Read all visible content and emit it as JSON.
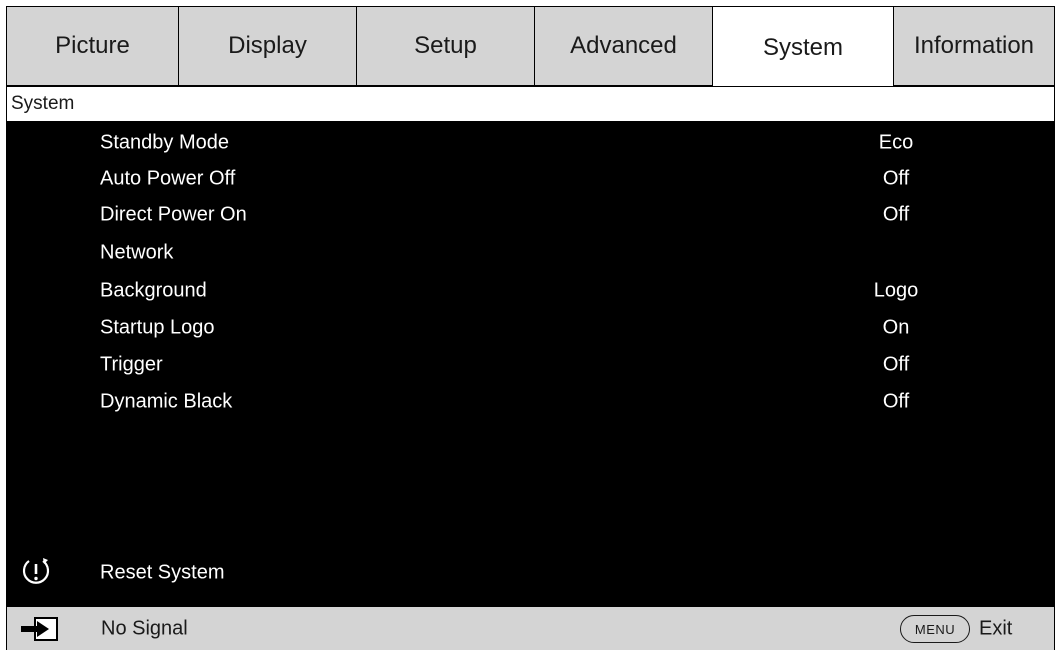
{
  "tabs": [
    {
      "label": "Picture",
      "active": false
    },
    {
      "label": "Display",
      "active": false
    },
    {
      "label": "Setup",
      "active": false
    },
    {
      "label": "Advanced",
      "active": false
    },
    {
      "label": "System",
      "active": true
    },
    {
      "label": "Information",
      "active": false
    }
  ],
  "section": {
    "title": "System"
  },
  "menu": {
    "items": [
      {
        "label": "Standby Mode",
        "value": "Eco"
      },
      {
        "label": "Auto Power Off",
        "value": "Off"
      },
      {
        "label": "Direct Power On",
        "value": "Off"
      },
      {
        "label": "Network",
        "value": ""
      },
      {
        "label": "Background",
        "value": "Logo"
      },
      {
        "label": "Startup Logo",
        "value": "On"
      },
      {
        "label": "Trigger",
        "value": "Off"
      },
      {
        "label": "Dynamic Black",
        "value": "Off"
      }
    ],
    "reset": {
      "label": "Reset System",
      "icon": "reset-power-icon"
    }
  },
  "status": {
    "input_icon": "input-source-icon",
    "signal": "No Signal",
    "menu_key": "MENU",
    "exit": "Exit"
  },
  "colors": {
    "panel": "#000000",
    "tab_inactive": "#d4d4d4",
    "tab_active": "#ffffff",
    "status_bar": "#d4d4d4"
  }
}
